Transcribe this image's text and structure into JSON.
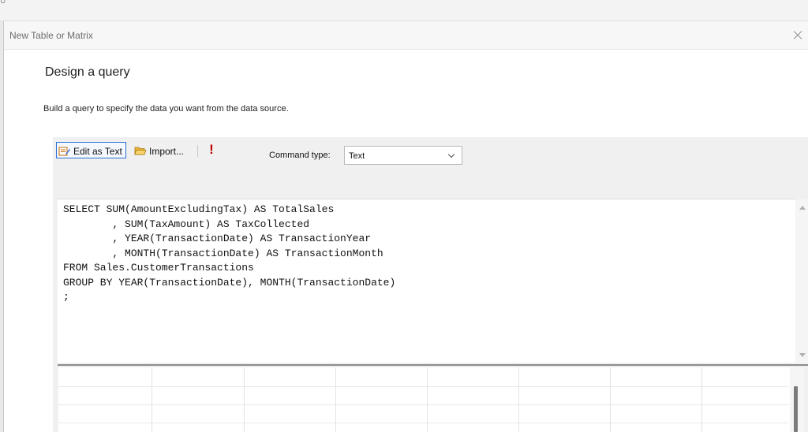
{
  "dialog": {
    "title": "New Table or Matrix",
    "heading": "Design a query",
    "description": "Build a query to specify the data you want from the data source."
  },
  "toolbar": {
    "edit_as_text_label": "Edit as Text",
    "import_label": "Import...",
    "run_label": "!",
    "command_type_label": "Command type:",
    "command_type_value": "Text"
  },
  "query": {
    "text": "SELECT SUM(AmountExcludingTax) AS TotalSales\n        , SUM(TaxAmount) AS TaxCollected\n        , YEAR(TransactionDate) AS TransactionYear\n        , MONTH(TransactionDate) AS TransactionMonth\nFROM Sales.CustomerTransactions\nGROUP BY YEAR(TransactionDate), MONTH(TransactionDate)\n;"
  },
  "icons": {
    "edit_as_text": "edit-text-icon",
    "import": "folder-open-icon",
    "run": "exclamation-run-icon",
    "close": "close-icon"
  },
  "colors": {
    "focus_border": "#2b6fd6",
    "run_icon": "#c00000",
    "panel_bg": "#f0f0f0"
  }
}
